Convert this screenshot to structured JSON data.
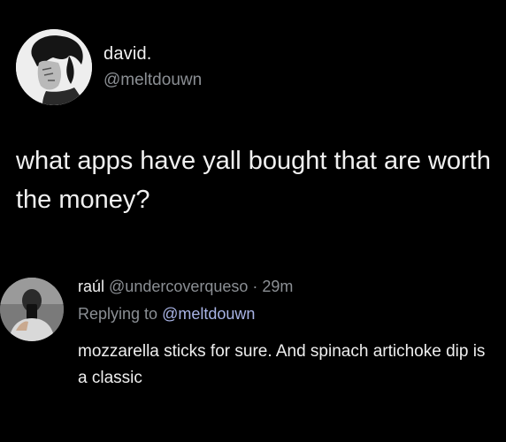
{
  "tweet": {
    "author_name": "david.",
    "author_handle": "@meltdouwn",
    "text": "what apps have yall bought that are worth the money?"
  },
  "reply": {
    "author_name": "raúl",
    "author_handle": "@undercoverqueso",
    "separator": " · ",
    "time": "29m",
    "replying_prefix": "Replying to ",
    "replying_handle": "@meltdouwn",
    "text": "mozzarella sticks for sure. And spinach artichoke dip is a classic"
  },
  "colors": {
    "background": "#000000",
    "primary_text": "#f0f0f0",
    "secondary_text": "#8b8f94",
    "mention": "#a9b4e6"
  }
}
